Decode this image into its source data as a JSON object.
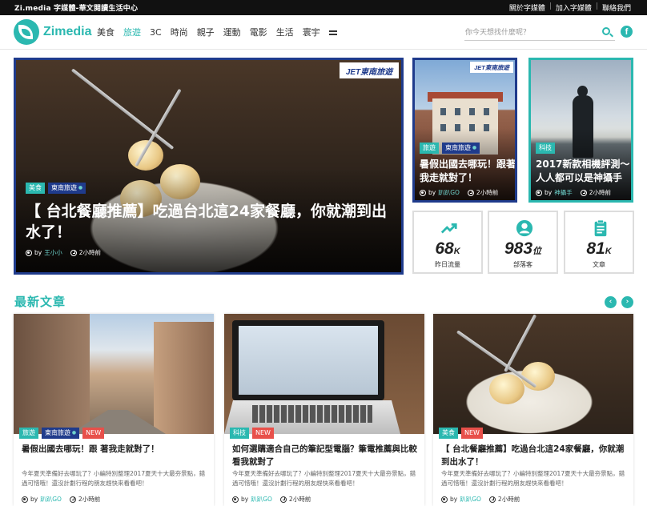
{
  "topbar": {
    "tagline": "Zi.media 字媒體-華文閱讀生活中心",
    "links": [
      "關於字媒體",
      "加入字媒體",
      "聯絡我們"
    ]
  },
  "nav": {
    "logo_text": "Zimedia",
    "menu": [
      "美食",
      "旅遊",
      "3C",
      "時尚",
      "親子",
      "運動",
      "電影",
      "生活",
      "寰宇"
    ],
    "active_menu": "旅遊",
    "search_placeholder": "你今天想找什麼呢？",
    "facebook": "f"
  },
  "colors": {
    "accent": "#2bb8b0",
    "navy": "#1f3b8c",
    "new_badge": "#e8504a"
  },
  "hero": {
    "sponsor": "JET東南旅遊",
    "tags": [
      "美食",
      "東南旅遊"
    ],
    "title": "【 台北餐廳推薦】吃過台北這24家餐廳，你就潮到出水了！",
    "by": "by",
    "author": "王小小",
    "time": "2小時前"
  },
  "side": [
    {
      "sponsor": "JET東南旅遊",
      "tags": [
        "旅遊",
        "東南旅遊"
      ],
      "title": "暑假出國去哪玩！跟著我走就對了！",
      "by": "by",
      "author": "趴趴GO",
      "time": "2小時前"
    },
    {
      "tags": [
        "科技"
      ],
      "title": "2017新款相機評測～人人都可以是神攝手",
      "by": "by",
      "author": "神攝手",
      "time": "2小時前"
    }
  ],
  "stats": [
    {
      "icon": "trending-up-icon",
      "value": "68",
      "unit": "K",
      "label": "昨日流量"
    },
    {
      "icon": "person-icon",
      "value": "983",
      "unit": "位",
      "label": "部落客"
    },
    {
      "icon": "clipboard-icon",
      "value": "81",
      "unit": "K",
      "label": "文章"
    }
  ],
  "latest": {
    "heading": "最新文章",
    "prev": "‹",
    "next": "›",
    "cards": [
      {
        "tags": [
          "旅遊",
          "東南旅遊"
        ],
        "badge": "NEW",
        "title": "暑假出國去哪玩！跟 著我走就對了！",
        "desc": "今年夏天準備好去哪玩了？小編特別整理2017夏天十大最夯景點，錯過可惜哦！還沒計劃行程的朋友趕快來看看吧！",
        "by": "by",
        "author": "趴趴GO",
        "time": "2小時前"
      },
      {
        "tags": [
          "科技"
        ],
        "badge": "NEW",
        "title": "如何選購適合自己的筆記型電腦？筆電推薦與比較看我就對了",
        "desc": "今年夏天準備好去哪玩了？小編特別整理2017夏天十大最夯景點，錯過可惜哦！還沒計劃行程的朋友趕快來看看吧！",
        "by": "by",
        "author": "趴趴GO",
        "time": "2小時前"
      },
      {
        "tags": [
          "美食"
        ],
        "badge": "NEW",
        "title": "【 台北餐廳推薦】吃過台北這24家餐廳，你就潮到出水了！",
        "desc": "今年夏天準備好去哪玩了？小編特別整理2017夏天十大最夯景點，錯過可惜哦！還沒計劃行程的朋友趕快來看看吧！",
        "by": "by",
        "author": "趴趴GO",
        "time": "2小時前"
      }
    ]
  }
}
